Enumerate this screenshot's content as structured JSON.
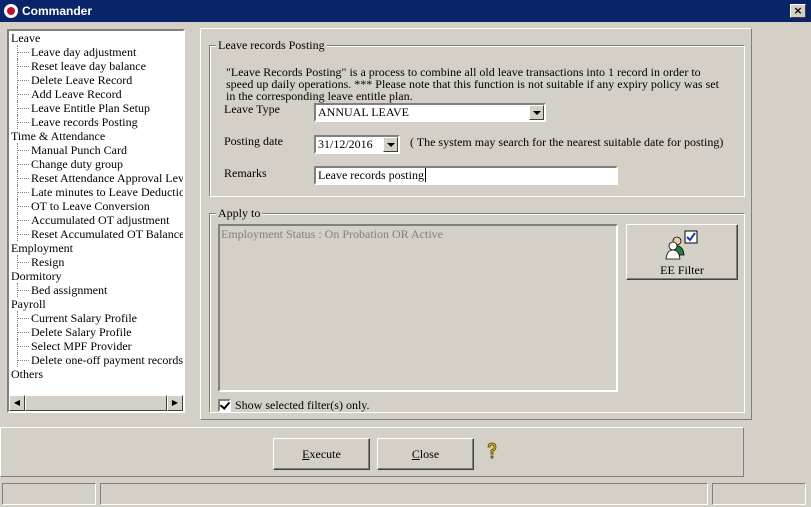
{
  "window": {
    "title": "Commander",
    "close_glyph": "×"
  },
  "tree": {
    "items": [
      {
        "label": "Leave",
        "level": 0
      },
      {
        "label": "Leave day adjustment",
        "level": 1
      },
      {
        "label": "Reset leave day balance",
        "level": 1
      },
      {
        "label": "Delete Leave Record",
        "level": 1
      },
      {
        "label": "Add Leave Record",
        "level": 1
      },
      {
        "label": "Leave Entitle Plan Setup",
        "level": 1
      },
      {
        "label": "Leave records Posting",
        "level": 1
      },
      {
        "label": "Time & Attendance",
        "level": 0
      },
      {
        "label": "Manual Punch Card",
        "level": 1
      },
      {
        "label": "Change duty group",
        "level": 1
      },
      {
        "label": "Reset Attendance Approval Leve",
        "level": 1
      },
      {
        "label": "Late minutes to Leave Deduction",
        "level": 1
      },
      {
        "label": "OT to Leave Conversion",
        "level": 1
      },
      {
        "label": "Accumulated OT adjustment",
        "level": 1
      },
      {
        "label": "Reset Accumulated OT Balance",
        "level": 1
      },
      {
        "label": "Employment",
        "level": 0
      },
      {
        "label": "Resign",
        "level": 1
      },
      {
        "label": "Dormitory",
        "level": 0
      },
      {
        "label": "Bed assignment",
        "level": 1
      },
      {
        "label": "Payroll",
        "level": 0
      },
      {
        "label": "Current Salary Profile",
        "level": 1
      },
      {
        "label": "Delete Salary Profile",
        "level": 1
      },
      {
        "label": "Select MPF Provider",
        "level": 1
      },
      {
        "label": "Delete one-off payment records",
        "level": 1
      },
      {
        "label": "Others",
        "level": 0
      }
    ],
    "scroll_left": "◀",
    "scroll_right": "▶"
  },
  "posting": {
    "legend": "Leave records Posting",
    "description": "\"Leave Records Posting\" is a process to combine all old leave transactions into 1 record in order to speed up daily operations. *** Please note that this function is not suitable if any expiry policy was set in the corresponding leave entitle plan.",
    "leave_type_label": "Leave Type",
    "leave_type_value": "ANNUAL LEAVE",
    "posting_date_label": "Posting date",
    "posting_date_value": "31/12/2016",
    "posting_date_note": "( The system may search for the nearest suitable date for posting)",
    "remarks_label": "Remarks",
    "remarks_value": "Leave records posting"
  },
  "apply_to": {
    "legend": "Apply to",
    "filter_text": "Employment Status : On Probation OR Active",
    "ee_filter_label": "EE Filter",
    "show_selected_label": "Show selected filter(s) only.",
    "show_selected_checked": true
  },
  "buttons": {
    "execute_accel": "E",
    "execute_rest": "xecute",
    "close_accel": "C",
    "close_rest": "lose"
  },
  "colors": {
    "title_bar": "#0a246a",
    "face": "#d4d0c8",
    "help_icon": "#e8c000"
  }
}
